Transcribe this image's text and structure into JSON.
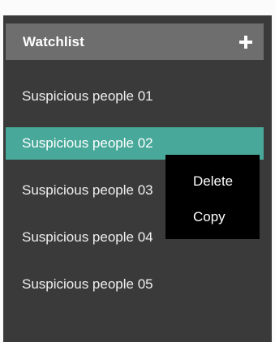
{
  "header": {
    "title": "Watchlist",
    "add_icon": "plus-icon"
  },
  "watchlist": {
    "items": [
      {
        "label": "Suspicious people 01"
      },
      {
        "label": "Suspicious people 02"
      },
      {
        "label": "Suspicious people 03"
      },
      {
        "label": "Suspicious people 04"
      },
      {
        "label": "Suspicious people 05"
      }
    ],
    "selected_index": 1
  },
  "context_menu": {
    "items": [
      {
        "label": "Delete"
      },
      {
        "label": "Copy"
      }
    ]
  },
  "colors": {
    "panel_bg": "#3a3a3a",
    "header_bg": "#6e6e6e",
    "selected_bg": "#48a89a",
    "menu_bg": "#000000"
  }
}
